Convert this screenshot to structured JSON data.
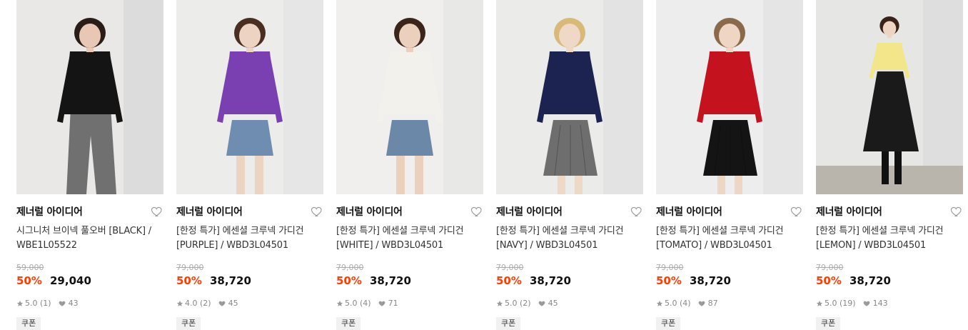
{
  "products": [
    {
      "brand": "제너럴 아이디어",
      "title": "시그니처 브이넥 풀오버 [BLACK] / WBE1L05522",
      "original_price": "59,000",
      "discount": "50%",
      "price": "29,040",
      "rating": "5.0 (1)",
      "likes": "43",
      "badge": "쿠폰",
      "bg": "#dcdcdc",
      "wall": "#e9e8e6",
      "top": "#141414",
      "bottom": "#707070",
      "skin": "#e8c8b4",
      "hair": "#2a1c16",
      "bottom_type": "pants"
    },
    {
      "brand": "제너럴 아이디어",
      "title": "[한정 특가] 에센셜 크루넥 가디건 [PURPLE] / WBD3L04501",
      "original_price": "79,000",
      "discount": "50%",
      "price": "38,720",
      "rating": "4.0 (2)",
      "likes": "45",
      "badge": "쿠폰",
      "bg": "#e6e6e6",
      "wall": "#ececeb",
      "top": "#7a3fb0",
      "bottom": "#6f8db0",
      "skin": "#edd3c2",
      "hair": "#4a2e22",
      "bottom_type": "skirt"
    },
    {
      "brand": "제너럴 아이디어",
      "title": "[한정 특가] 에센셜 크루넥 가디건 [WHITE] / WBD3L04501",
      "original_price": "79,000",
      "discount": "50%",
      "price": "38,720",
      "rating": "5.0 (4)",
      "likes": "71",
      "badge": "쿠폰",
      "bg": "#e8e8e6",
      "wall": "#f0efee",
      "top": "#f3f1ec",
      "bottom": "#6b88a8",
      "skin": "#ecd0be",
      "hair": "#3b2419",
      "bottom_type": "skirt"
    },
    {
      "brand": "제너럴 아이디어",
      "title": "[한정 특가] 에센셜 크루넥 가디건 [NAVY] / WBD3L04501",
      "original_price": "79,000",
      "discount": "50%",
      "price": "38,720",
      "rating": "5.0 (2)",
      "likes": "45",
      "badge": "쿠폰",
      "bg": "#e3e3e3",
      "wall": "#ebebea",
      "top": "#1d2350",
      "bottom": "#6e6e6e",
      "skin": "#f0d8c6",
      "hair": "#d9b977",
      "bottom_type": "pleat"
    },
    {
      "brand": "제너럴 아이디어",
      "title": "[한정 특가] 에센셜 크루넥 가디건 [TOMATO] / WBD3L04501",
      "original_price": "79,000",
      "discount": "50%",
      "price": "38,720",
      "rating": "5.0 (4)",
      "likes": "87",
      "badge": "쿠폰",
      "bg": "#e5e5e5",
      "wall": "#ededed",
      "top": "#c4121f",
      "bottom": "#141414",
      "skin": "#efd6c4",
      "hair": "#8a6a4a",
      "bottom_type": "pleat"
    },
    {
      "brand": "제너럴 아이디어",
      "title": "[한정 특가] 에센셜 크루넥 가디건 [LEMON] / WBD3L04501",
      "original_price": "79,000",
      "discount": "50%",
      "price": "38,720",
      "rating": "5.0 (19)",
      "likes": "143",
      "badge": "쿠폰",
      "bg": "#dedede",
      "wall": "#e6e6e5",
      "top": "#f3e58a",
      "bottom": "#1a1a1a",
      "skin": "#eed4c2",
      "hair": "#3a2218",
      "bottom_type": "long"
    }
  ],
  "icons": {
    "wishlist": "heart-outline-icon",
    "rating": "star-icon",
    "likes": "heart-filled-icon"
  },
  "colors": {
    "discount": "#ff3d00",
    "original_price": "#aaaaaa",
    "meta": "#888888"
  }
}
